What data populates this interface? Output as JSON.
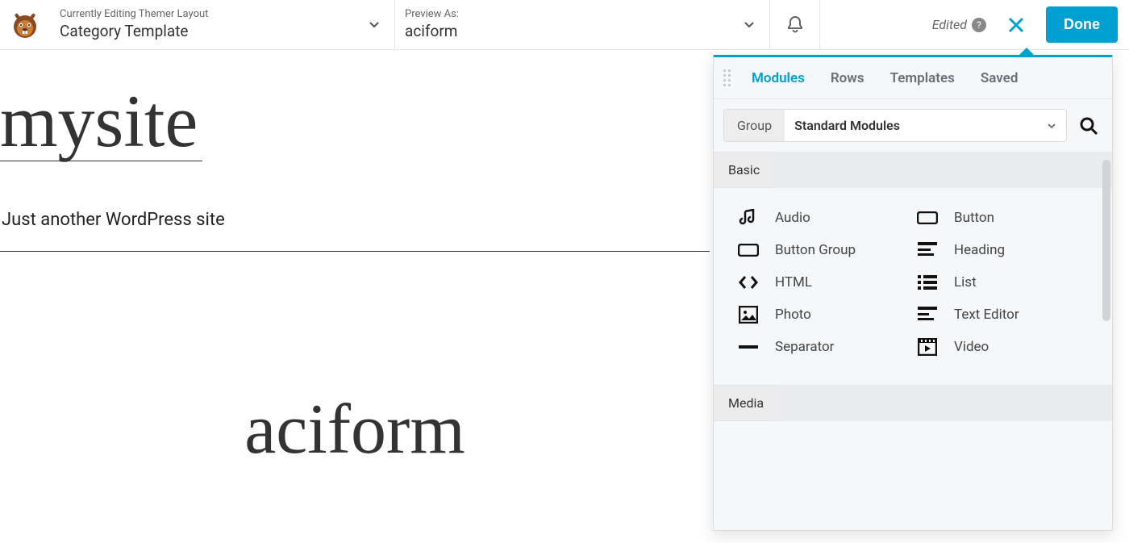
{
  "toolbar": {
    "editing_label": "Currently Editing Themer Layout",
    "layout_name": "Category Template",
    "preview_label": "Preview As:",
    "preview_value": "aciform",
    "status": "Edited",
    "done_label": "Done"
  },
  "preview": {
    "site_title": "mysite",
    "tagline": "Just another WordPress site",
    "page_heading": "aciform"
  },
  "panel": {
    "tabs": [
      "Modules",
      "Rows",
      "Templates",
      "Saved"
    ],
    "active_tab": 0,
    "filter": {
      "group_label": "Group",
      "selected": "Standard Modules"
    },
    "sections": [
      {
        "title": "Basic",
        "modules": [
          {
            "icon": "audio",
            "label": "Audio"
          },
          {
            "icon": "button",
            "label": "Button"
          },
          {
            "icon": "button-group",
            "label": "Button Group"
          },
          {
            "icon": "heading",
            "label": "Heading"
          },
          {
            "icon": "html",
            "label": "HTML"
          },
          {
            "icon": "list",
            "label": "List"
          },
          {
            "icon": "photo",
            "label": "Photo"
          },
          {
            "icon": "text-editor",
            "label": "Text Editor"
          },
          {
            "icon": "separator",
            "label": "Separator"
          },
          {
            "icon": "video",
            "label": "Video"
          }
        ]
      },
      {
        "title": "Media",
        "modules": []
      }
    ]
  }
}
